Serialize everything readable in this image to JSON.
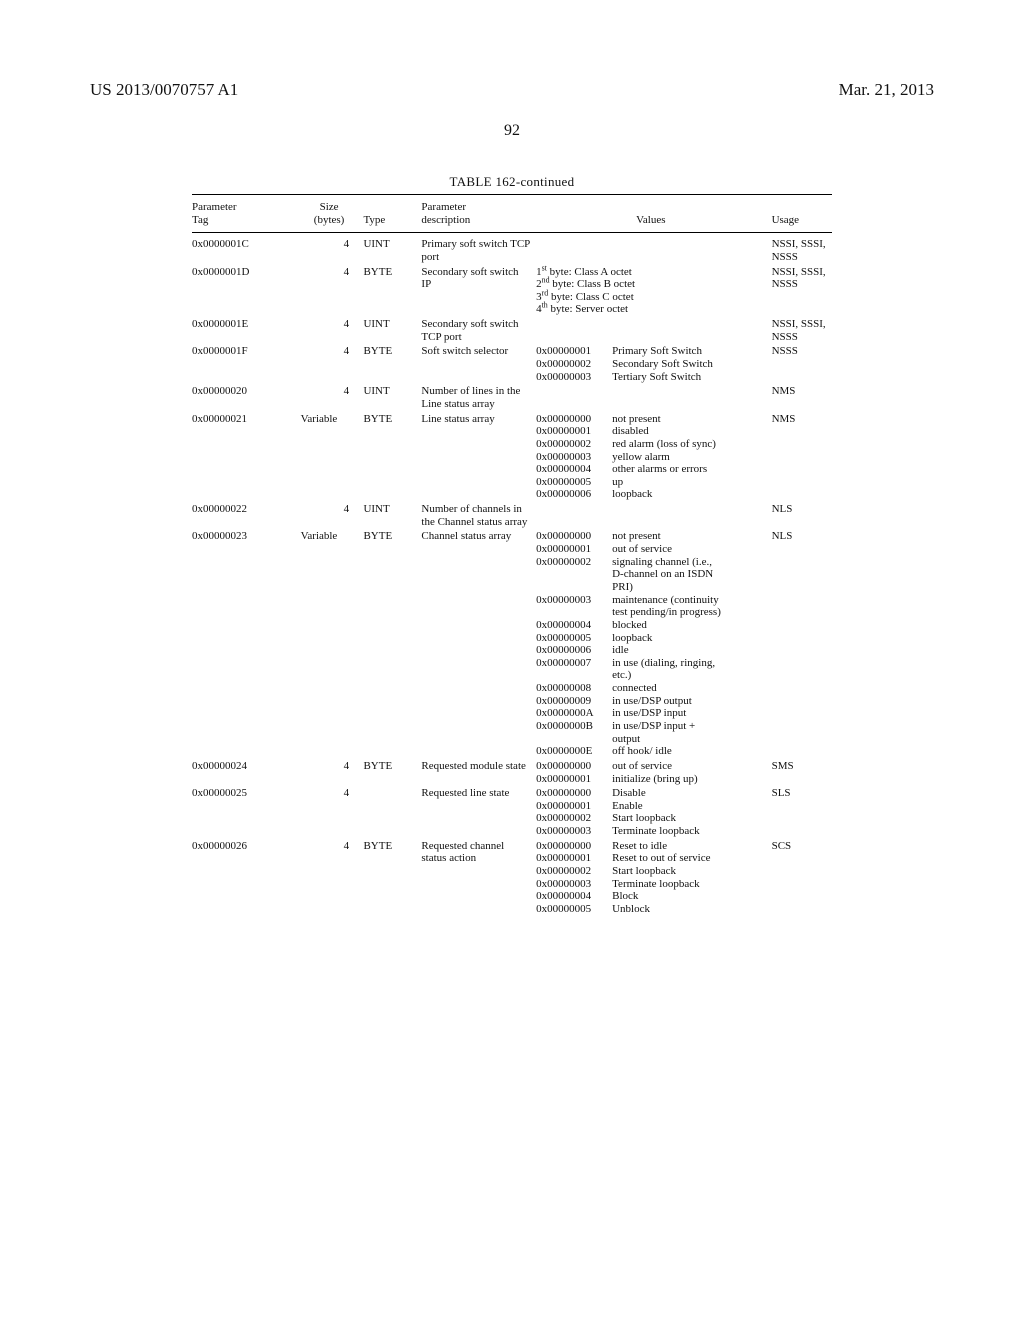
{
  "header": {
    "pub": "US 2013/0070757 A1",
    "date": "Mar. 21, 2013"
  },
  "pagenum": "92",
  "table": {
    "caption": "TABLE 162-continued",
    "head": {
      "tag": "Parameter\nTag",
      "size": "Size\n(bytes)",
      "type": "Type",
      "desc": "Parameter\ndescription",
      "values_span": "Values",
      "usage": "Usage"
    }
  },
  "rows": [
    {
      "tag": "0x0000001C",
      "size": "4",
      "type": "UINT",
      "desc": "Primary soft switch TCP port",
      "values": [],
      "usage": "NSSI, SSSI, NSSS"
    },
    {
      "tag": "0x0000001D",
      "size": "4",
      "type": "BYTE",
      "desc": "Secondary soft switch IP",
      "values_html": "1<sup>st</sup> byte: Class A octet<br>2<sup>nd</sup> byte: Class B octet<br>3<sup>rd</sup> byte: Class C octet<br>4<sup>th</sup> byte: Server octet",
      "usage": "NSSI, SSSI, NSSS"
    },
    {
      "tag": "0x0000001E",
      "size": "4",
      "type": "UINT",
      "desc": "Secondary soft switch TCP port",
      "values": [],
      "usage": "NSSI, SSSI, NSSS"
    },
    {
      "tag": "0x0000001F",
      "size": "4",
      "type": "BYTE",
      "desc": "Soft switch selector",
      "values": [
        {
          "k": "0x00000001",
          "l": "Primary Soft Switch"
        },
        {
          "k": "0x00000002",
          "l": "Secondary Soft Switch"
        },
        {
          "k": "0x00000003",
          "l": "Tertiary Soft Switch"
        }
      ],
      "usage": "NSSS"
    },
    {
      "tag": "0x00000020",
      "size": "4",
      "type": "UINT",
      "desc": "Number of lines in the Line status array",
      "values": [],
      "usage": "NMS"
    },
    {
      "tag": "0x00000021",
      "size": "Variable",
      "type": "BYTE",
      "desc": "Line status array",
      "values": [
        {
          "k": "0x00000000",
          "l": "not present"
        },
        {
          "k": "0x00000001",
          "l": "disabled"
        },
        {
          "k": "0x00000002",
          "l": "red alarm (loss of sync)"
        },
        {
          "k": "0x00000003",
          "l": "yellow alarm"
        },
        {
          "k": "0x00000004",
          "l": "other alarms or errors"
        },
        {
          "k": "0x00000005",
          "l": "up"
        },
        {
          "k": "0x00000006",
          "l": "loopback"
        }
      ],
      "usage": "NMS"
    },
    {
      "tag": "0x00000022",
      "size": "4",
      "type": "UINT",
      "desc": "Number of channels in the Channel status array",
      "values": [],
      "usage": "NLS"
    },
    {
      "tag": "0x00000023",
      "size": "Variable",
      "type": "BYTE",
      "desc": "Channel status array",
      "values": [
        {
          "k": "0x00000000",
          "l": "not present"
        },
        {
          "k": "0x00000001",
          "l": "out of service"
        },
        {
          "k": "0x00000002",
          "l": "signaling channel (i.e., D-channel on an ISDN PRI)"
        },
        {
          "k": "0x00000003",
          "l": "maintenance (continuity test pending/in progress)"
        },
        {
          "k": "0x00000004",
          "l": "blocked"
        },
        {
          "k": "0x00000005",
          "l": "loopback"
        },
        {
          "k": "0x00000006",
          "l": "idle"
        },
        {
          "k": "0x00000007",
          "l": "in use (dialing, ringing, etc.)"
        },
        {
          "k": "0x00000008",
          "l": "connected"
        },
        {
          "k": "0x00000009",
          "l": "in use/DSP output"
        },
        {
          "k": "0x0000000A",
          "l": "in use/DSP input"
        },
        {
          "k": "0x0000000B",
          "l": "in use/DSP input + output"
        },
        {
          "k": "0x0000000E",
          "l": "off hook/ idle"
        }
      ],
      "usage": "NLS"
    },
    {
      "tag": "0x00000024",
      "size": "4",
      "type": "BYTE",
      "desc": "Requested module state",
      "values": [
        {
          "k": "0x00000000",
          "l": "out of service"
        },
        {
          "k": "0x00000001",
          "l": "initialize (bring up)"
        }
      ],
      "usage": "SMS"
    },
    {
      "tag": "0x00000025",
      "size": "4",
      "type": "",
      "desc": "Requested line state",
      "values": [
        {
          "k": "0x00000000",
          "l": "Disable"
        },
        {
          "k": "0x00000001",
          "l": "Enable"
        },
        {
          "k": "0x00000002",
          "l": "Start loopback"
        },
        {
          "k": "0x00000003",
          "l": "Terminate loopback"
        }
      ],
      "usage": "SLS"
    },
    {
      "tag": "0x00000026",
      "size": "4",
      "type": "BYTE",
      "desc": "Requested channel status action",
      "values": [
        {
          "k": "0x00000000",
          "l": "Reset to idle"
        },
        {
          "k": "0x00000001",
          "l": "Reset to out of service"
        },
        {
          "k": "0x00000002",
          "l": "Start loopback"
        },
        {
          "k": "0x00000003",
          "l": "Terminate loopback"
        },
        {
          "k": "0x00000004",
          "l": "Block"
        },
        {
          "k": "0x00000005",
          "l": "Unblock"
        }
      ],
      "usage": "SCS"
    }
  ]
}
